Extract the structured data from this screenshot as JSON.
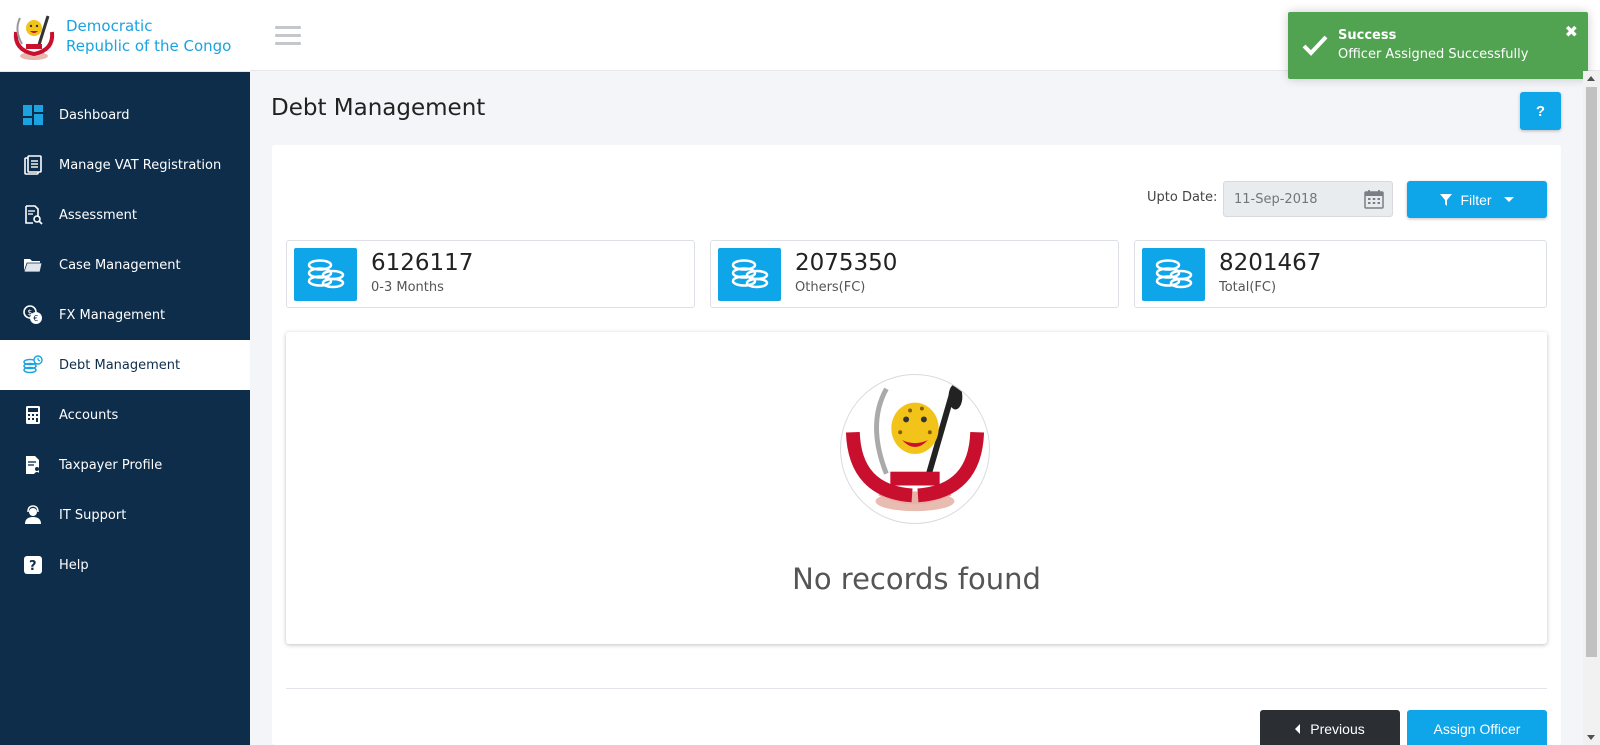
{
  "brand": {
    "line1": "Democratic",
    "line2": "Republic of the Congo"
  },
  "sidebar": {
    "items": [
      {
        "label": "Dashboard",
        "icon": "dashboard-icon"
      },
      {
        "label": "Manage VAT Registration",
        "icon": "document-list-icon"
      },
      {
        "label": "Assessment",
        "icon": "document-search-icon"
      },
      {
        "label": "Case Management",
        "icon": "folder-icon"
      },
      {
        "label": "FX Management",
        "icon": "currency-exchange-icon"
      },
      {
        "label": "Debt Management",
        "icon": "coins-clock-icon",
        "active": true
      },
      {
        "label": "Accounts",
        "icon": "calculator-icon"
      },
      {
        "label": "Taxpayer Profile",
        "icon": "profile-document-icon"
      },
      {
        "label": "IT Support",
        "icon": "support-agent-icon"
      },
      {
        "label": "Help",
        "icon": "question-icon"
      }
    ]
  },
  "toast": {
    "title": "Success",
    "message": "Officer Assigned Successfully",
    "close": "✖",
    "color": "#51a351"
  },
  "page": {
    "title": "Debt Management",
    "help_label": "?"
  },
  "filters": {
    "date_label": "Upto Date:",
    "date_placeholder": "11-Sep-2018",
    "filter_label": "Filter"
  },
  "stats": [
    {
      "value": "6126117",
      "label": "0-3 Months"
    },
    {
      "value": "2075350",
      "label": "Others(FC)"
    },
    {
      "value": "8201467",
      "label": "Total(FC)"
    }
  ],
  "empty": {
    "message": "No records found"
  },
  "actions": {
    "previous_label": "Previous",
    "assign_label": "Assign Officer"
  },
  "colors": {
    "sidebar": "#0e2d4a",
    "accent": "#0ea5e9",
    "brand_text": "#1aa3e0",
    "success": "#51a351",
    "dark_button": "#2b2f33"
  }
}
